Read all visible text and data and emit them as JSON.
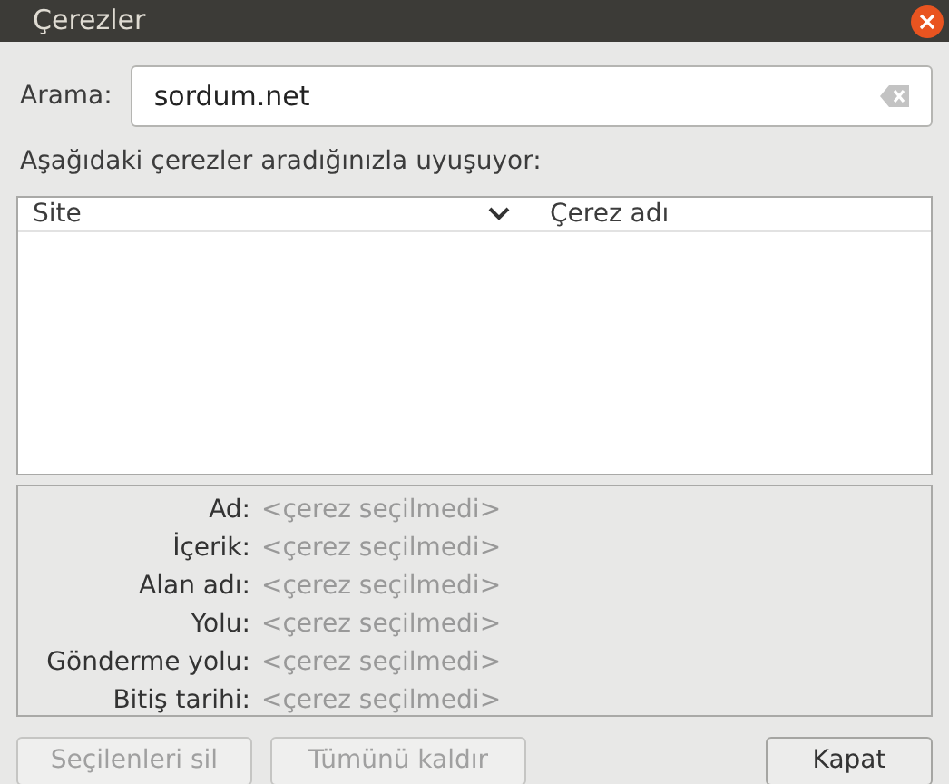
{
  "window": {
    "title": "Çerezler"
  },
  "search": {
    "label": "Arama:",
    "value": "sordum.net"
  },
  "results_label": "Aşağıdaki çerezler aradığınızla uyuşuyor:",
  "table": {
    "columns": [
      {
        "label": "Site",
        "sorted": true
      },
      {
        "label": "Çerez adı",
        "sorted": false
      }
    ]
  },
  "details": [
    {
      "label": "Ad:",
      "value": "<çerez seçilmedi>"
    },
    {
      "label": "İçerik:",
      "value": "<çerez seçilmedi>"
    },
    {
      "label": "Alan adı:",
      "value": "<çerez seçilmedi>"
    },
    {
      "label": "Yolu:",
      "value": "<çerez seçilmedi>"
    },
    {
      "label": "Gönderme yolu:",
      "value": "<çerez seçilmedi>"
    },
    {
      "label": "Bitiş tarihi:",
      "value": "<çerez seçilmedi>"
    }
  ],
  "buttons": [
    {
      "label": "Seçilenleri sil",
      "disabled": true
    },
    {
      "label": "Tümünü kaldır",
      "disabled": true
    },
    {
      "label": "Kapat",
      "disabled": false
    }
  ]
}
